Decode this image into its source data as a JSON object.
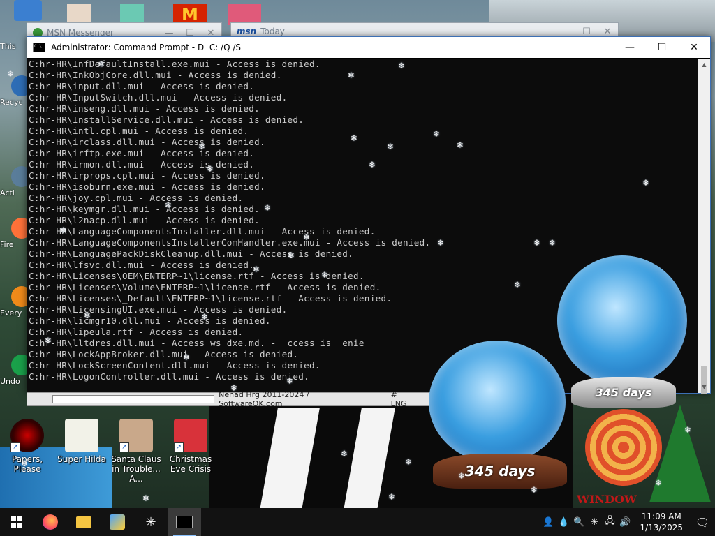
{
  "background_windows": {
    "msn_messenger": {
      "title": "MSN Messenger"
    },
    "msn_today": {
      "logo": "msn",
      "title": "Today"
    }
  },
  "cmd": {
    "title": "Administrator: Command Prompt - D  C: /Q /S",
    "minimize": "—",
    "maximize": "☐",
    "close": "✕",
    "lines": [
      "C:hr-HR\\InfDefaultInstall.exe.mui - Access is denied.",
      "C:hr-HR\\InkObjCore.dll.mui - Access is denied.",
      "C:hr-HR\\input.dll.mui - Access is denied.",
      "C:hr-HR\\InputSwitch.dll.mui - Access is denied.",
      "C:hr-HR\\inseng.dll.mui - Access is denied.",
      "C:hr-HR\\InstallService.dll.mui - Access is denied.",
      "C:hr-HR\\intl.cpl.mui - Access is denied.",
      "C:hr-HR\\irclass.dll.mui - Access is denied.",
      "C:hr-HR\\irftp.exe.mui - Access is denied.",
      "C:hr-HR\\irmon.dll.mui - Access is denied.",
      "C:hr-HR\\irprops.cpl.mui - Access is denied.",
      "C:hr-HR\\isoburn.exe.mui - Access is denied.",
      "C:hr-HR\\joy.cpl.mui - Access is denied.",
      "C:hr-HR\\keymgr.dll.mui - Access is denied.",
      "C:hr-HR\\l2nacp.dll.mui - Access is denied.",
      "C:hr-HR\\LanguageComponentsInstaller.dll.mui - Access is denied.",
      "C:hr-HR\\LanguageComponentsInstallerComHandler.exe.mui - Access is denied.",
      "C:hr-HR\\LanguagePackDiskCleanup.dll.mui - Access is denied.",
      "C:hr-HR\\lfsvc.dll.mui - Access is denied.",
      "C:hr-HR\\Licenses\\OEM\\ENTERP~1\\license.rtf - Access is denied.",
      "C:hr-HR\\Licenses\\Volume\\ENTERP~1\\license.rtf - Access is denied.",
      "C:hr-HR\\Licenses\\_Default\\ENTERP~1\\license.rtf - Access is denied.",
      "C:hr-HR\\LicensingUI.exe.mui - Access is denied.",
      "C:hr-HR\\licmgr10.dll.mui - Access is denied.",
      "C:hr-HR\\lipeula.rtf - Access is denied.",
      "C:hr-HR\\lltdres.dll.mui - Access ws dxe.md. -  ccess is  enie",
      "C:hr-HR\\LockAppBroker.dll.mui - Access is denied.",
      "C:hr-HR\\LockScreenContent.dll.mui - Access is denied.",
      "C:hr-HR\\LogonController.dll.mui - Access is denied."
    ]
  },
  "footer_strip": {
    "copyright": "Nenad Hrg 2011-2024 / SoftwareOK.com",
    "lng": "# LNG"
  },
  "desktop_icons": [
    {
      "label": "Papers, Please",
      "icon": "papers-please-icon"
    },
    {
      "label": "Super Hilda",
      "icon": "super-hilda-icon"
    },
    {
      "label": "Santa Claus in Trouble... A...",
      "icon": "santa-claus-icon"
    },
    {
      "label": "Christmas Eve Crisis",
      "icon": "christmas-eve-icon"
    }
  ],
  "left_icons": [
    "This",
    "Recyc",
    "Acti",
    "Fire",
    "Every",
    "Undo"
  ],
  "globes": {
    "left_days": "345 days",
    "right_days": "345 days",
    "brand": "WINDOW"
  },
  "taskbar": {
    "buttons": [
      "start",
      "firefox",
      "file-explorer",
      "app",
      "snowflake",
      "command-prompt"
    ],
    "time": "11:09 AM",
    "date": "1/13/2025"
  }
}
